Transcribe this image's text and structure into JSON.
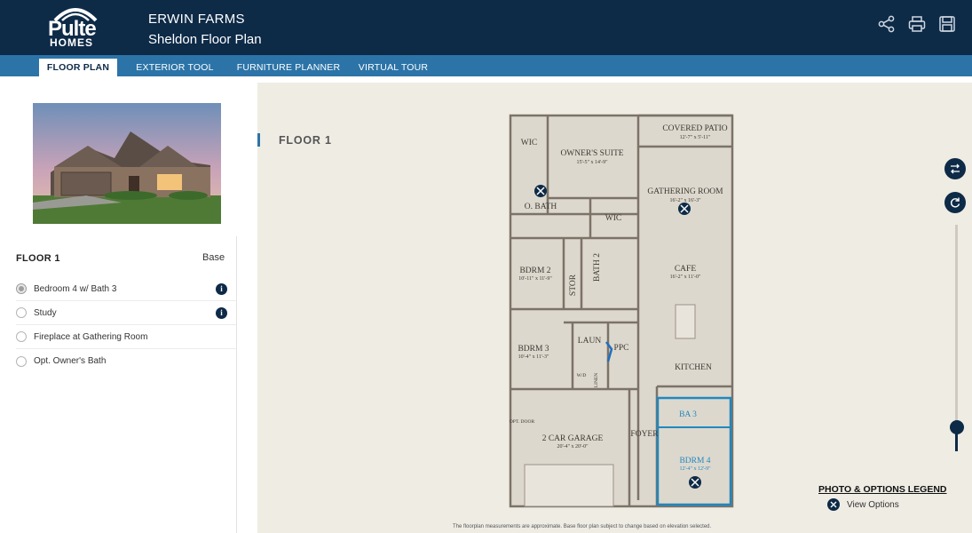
{
  "header": {
    "logo_word": "Pulte",
    "logo_sub": "HOMES",
    "community": "ERWIN FARMS",
    "plan_name": "Sheldon Floor Plan",
    "actions": [
      {
        "icon": "share-icon"
      },
      {
        "icon": "print-icon"
      },
      {
        "icon": "save-icon"
      }
    ]
  },
  "tabs": [
    {
      "label": "FLOOR PLAN",
      "active": true
    },
    {
      "label": "EXTERIOR TOOL",
      "active": false
    },
    {
      "label": "FURNITURE PLANNER",
      "active": false
    },
    {
      "label": "VIRTUAL TOUR",
      "active": false
    }
  ],
  "options_panel": {
    "floor_label": "FLOOR 1",
    "base_label": "Base",
    "options": [
      {
        "label": "Bedroom 4 w/ Bath 3",
        "selected": true,
        "info": true
      },
      {
        "label": "Study",
        "selected": false,
        "info": true
      },
      {
        "label": "Fireplace at Gathering Room",
        "selected": false,
        "info": false
      },
      {
        "label": "Opt. Owner's Bath",
        "selected": false,
        "info": false
      }
    ]
  },
  "canvas": {
    "floor_title": "FLOOR 1",
    "rooms": [
      {
        "name": "COVERED PATIO",
        "dims": "12'-7\" x 5'-11\""
      },
      {
        "name": "WIC",
        "dims": ""
      },
      {
        "name": "OWNER'S SUITE",
        "dims": "15'-5\" x 14'-9\""
      },
      {
        "name": "O. BATH",
        "dims": ""
      },
      {
        "name": "WIC",
        "dims": ""
      },
      {
        "name": "GATHERING ROOM",
        "dims": "16'-2\" x 16'-3\""
      },
      {
        "name": "BDRM 2",
        "dims": "10'-11\" x 11'-9\""
      },
      {
        "name": "STOR",
        "dims": ""
      },
      {
        "name": "BATH 2",
        "dims": ""
      },
      {
        "name": "CAFE",
        "dims": "16'-2\" x 11'-0\""
      },
      {
        "name": "BDRM 3",
        "dims": "10'-4\" x 11'-3\""
      },
      {
        "name": "LAUN",
        "dims": ""
      },
      {
        "name": "PPC",
        "dims": ""
      },
      {
        "name": "KITCHEN",
        "dims": ""
      },
      {
        "name": "W/D",
        "dims": ""
      },
      {
        "name": "LINEN",
        "dims": ""
      },
      {
        "name": "2 CAR GARAGE",
        "dims": "20'-4\" x 20'-0\""
      },
      {
        "name": "OPT. DOOR",
        "dims": ""
      },
      {
        "name": "FOYER",
        "dims": ""
      },
      {
        "name": "BA 3",
        "dims": ""
      },
      {
        "name": "BDRM 4",
        "dims": "12'-4\" x 12'-9\""
      }
    ],
    "legend_title": "PHOTO & OPTIONS LEGEND",
    "legend_item": "View Options",
    "footnote": "The floorplan measurements are approximate. Base floor plan subject to change based on elevation selected.",
    "colors": {
      "header": "#0d2a47",
      "tabbar": "#2c74a8",
      "canvas": "#efece4",
      "wall": "#7c7368",
      "option_highlight": "#1f88c0"
    }
  }
}
